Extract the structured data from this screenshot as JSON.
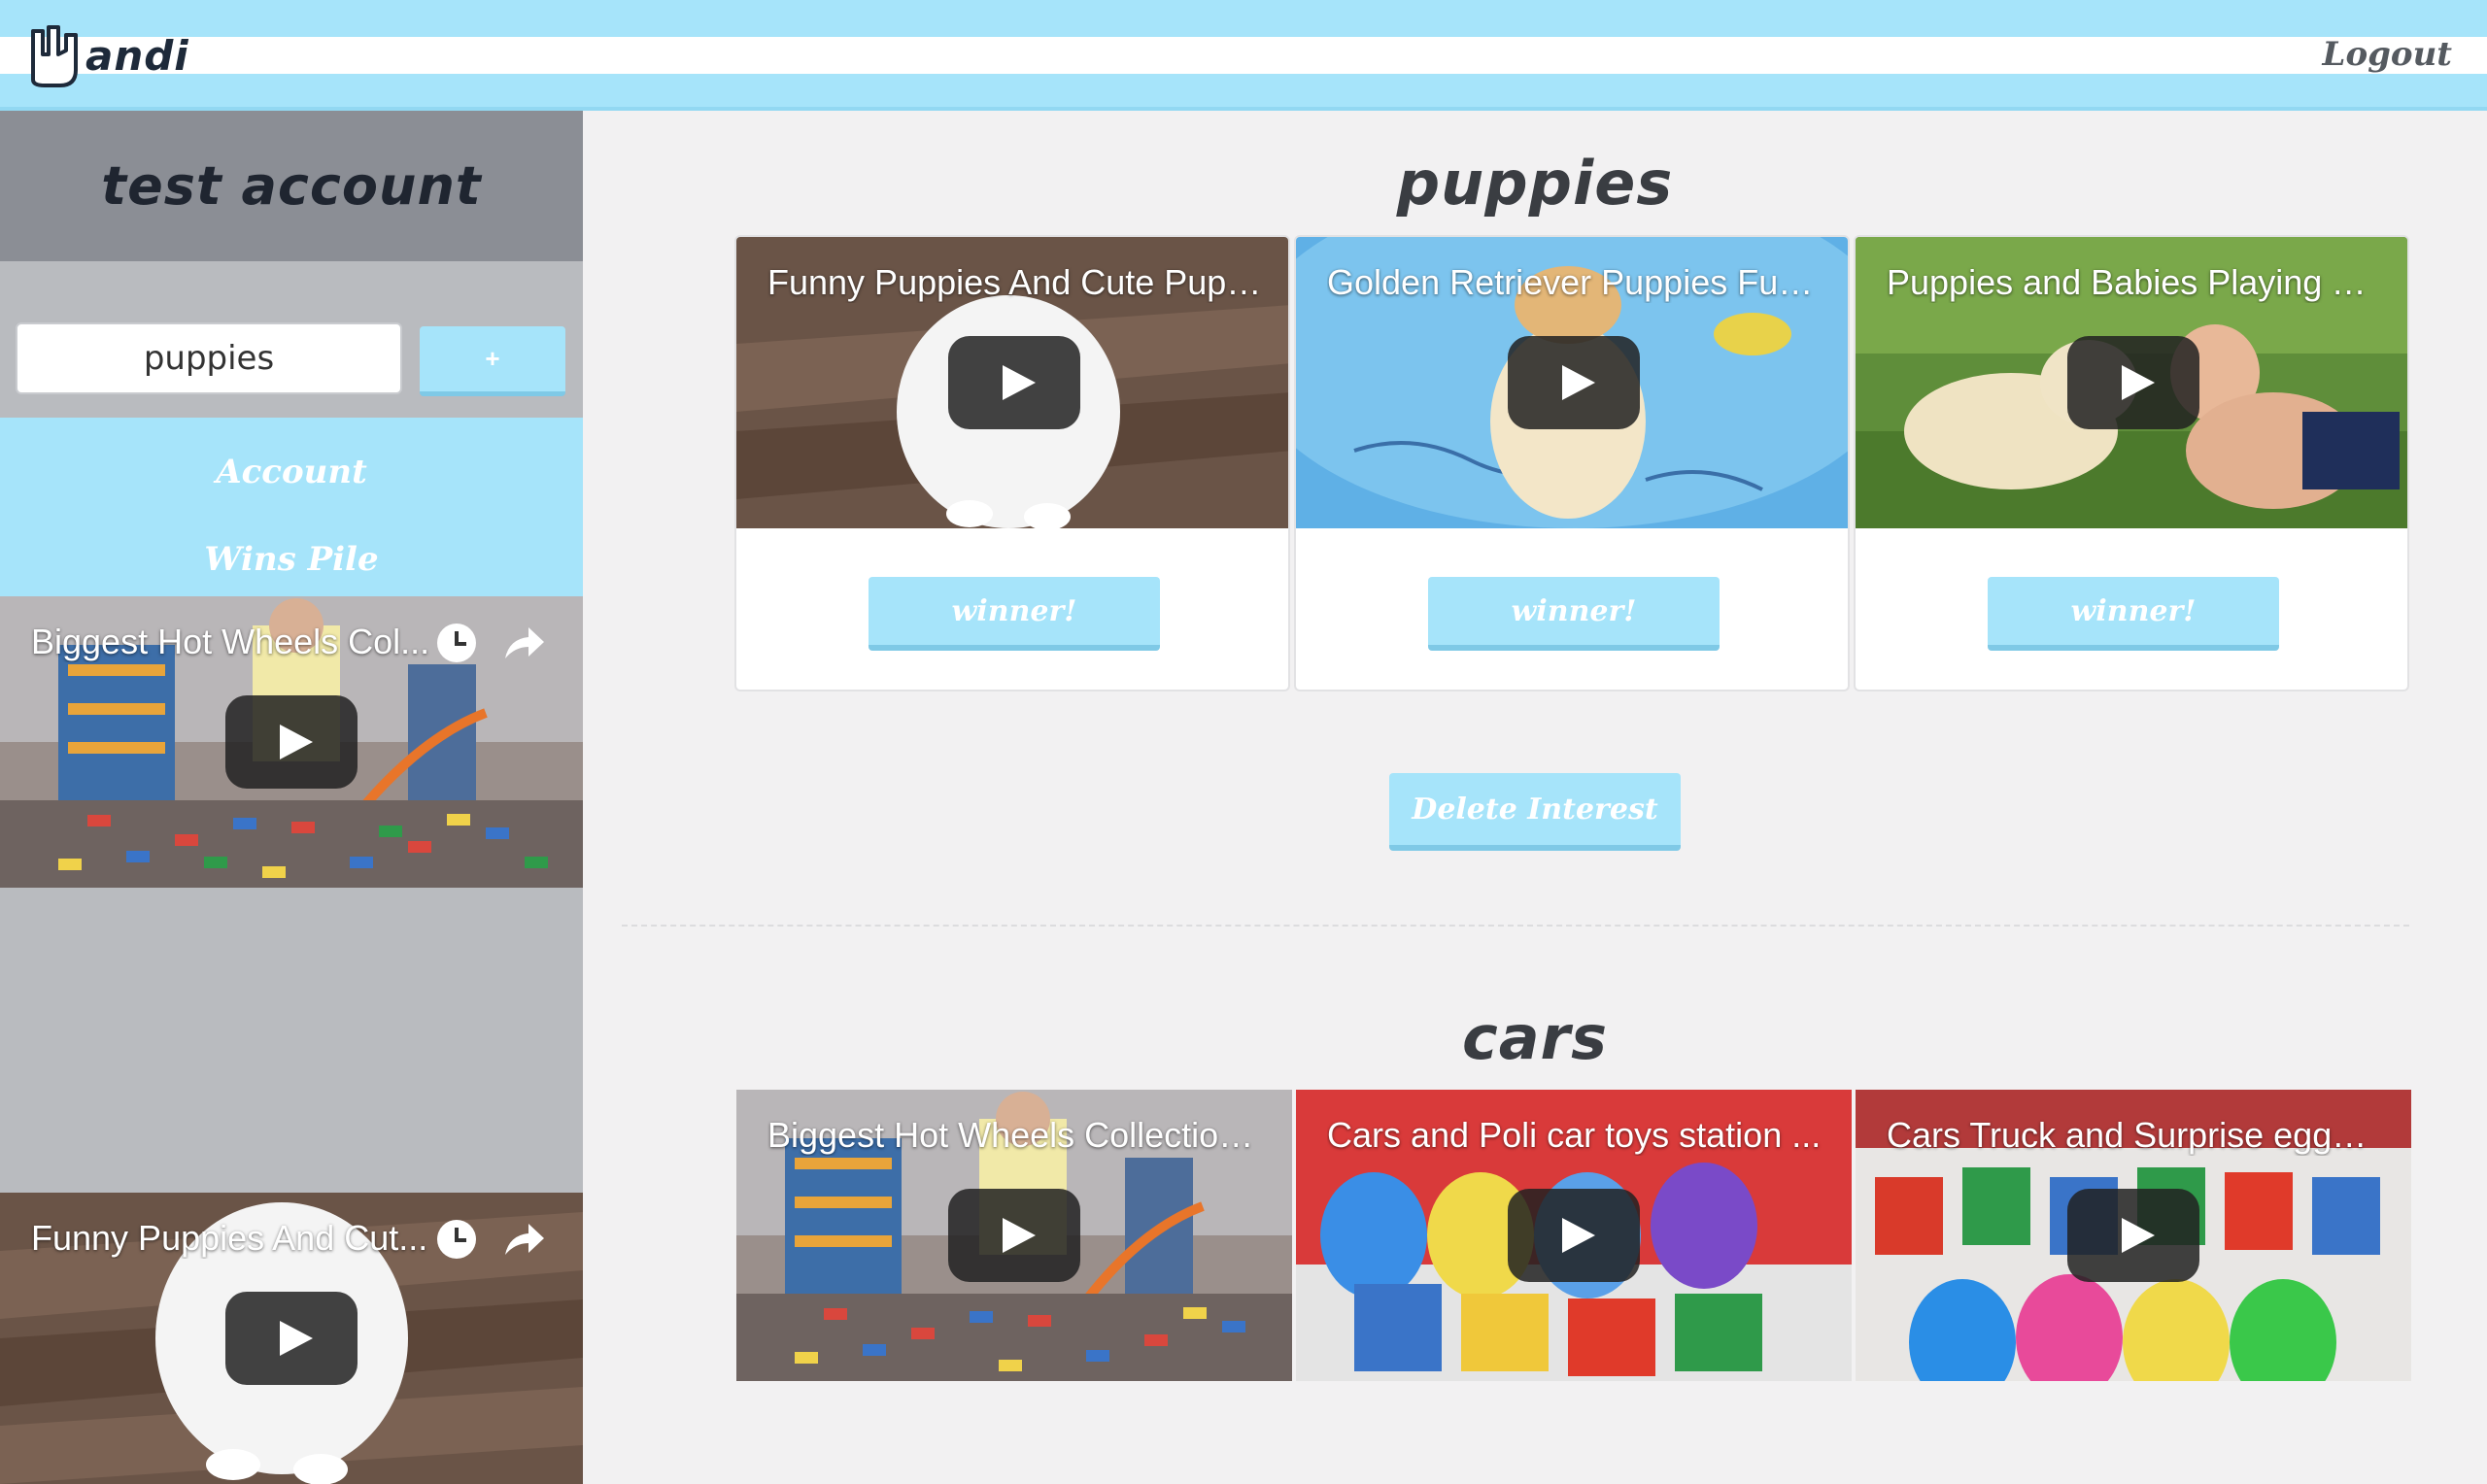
{
  "header": {
    "logo_text": "andi",
    "logout_label": "Logout"
  },
  "sidebar": {
    "account_name": "test account",
    "interest_input_value": "puppies",
    "add_button_label": "+",
    "nav": [
      {
        "label": "Account"
      },
      {
        "label": "Wins Pile"
      }
    ],
    "videos": [
      {
        "title": "Biggest Hot Wheels Col..."
      },
      {
        "title": "Funny Puppies And Cut..."
      }
    ]
  },
  "main": {
    "interests": [
      {
        "name": "puppies",
        "videos": [
          {
            "title": "Funny Puppies And Cute Pupp...",
            "button": "winner!"
          },
          {
            "title": "Golden Retriever Puppies Funn...",
            "button": "winner!"
          },
          {
            "title": "Puppies and Babies Playing To...",
            "button": "winner!"
          }
        ],
        "delete_label": "Delete Interest"
      },
      {
        "name": "cars",
        "videos": [
          {
            "title": "Biggest Hot Wheels Collection..."
          },
          {
            "title": "Cars and Poli car toys station ..."
          },
          {
            "title": "Cars Truck and Surprise eggs ..."
          }
        ]
      }
    ]
  },
  "colors": {
    "accent": "#a6e4fa",
    "sidebar_bg": "#b9bbbf",
    "header_bg": "#8b8e95",
    "page_bg": "#f2f1f2",
    "highlight_border": "#3ed24a"
  }
}
